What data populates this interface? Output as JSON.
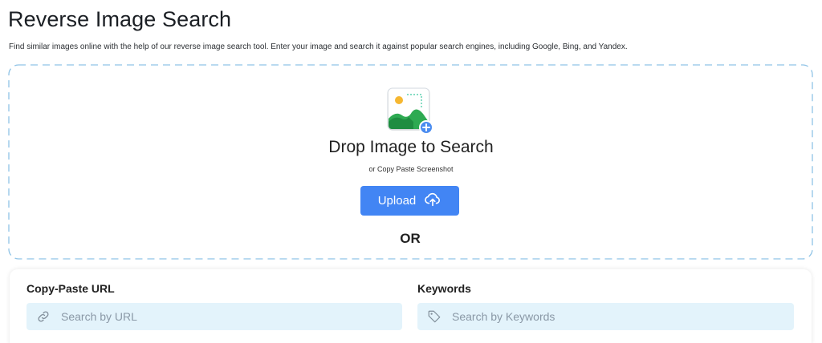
{
  "header": {
    "title": "Reverse Image Search",
    "description": "Find similar images online with the help of our reverse image search tool. Enter your image and search it against popular search engines, including Google, Bing, and Yandex."
  },
  "dropzone": {
    "illustration_icon": "image-add-icon",
    "title": "Drop Image to Search",
    "subtitle": "or Copy Paste Screenshot",
    "upload_label": "Upload",
    "upload_icon": "cloud-upload-icon",
    "or_label": "OR"
  },
  "search": {
    "url": {
      "label": "Copy-Paste URL",
      "placeholder": "Search by URL",
      "value": "",
      "icon": "link-icon"
    },
    "keywords": {
      "label": "Keywords",
      "placeholder": "Search by Keywords",
      "value": "",
      "icon": "tag-icon"
    }
  },
  "colors": {
    "accent": "#4285f4",
    "dashed_border": "#8fc3e6",
    "input_bg": "#e3f3fb"
  }
}
